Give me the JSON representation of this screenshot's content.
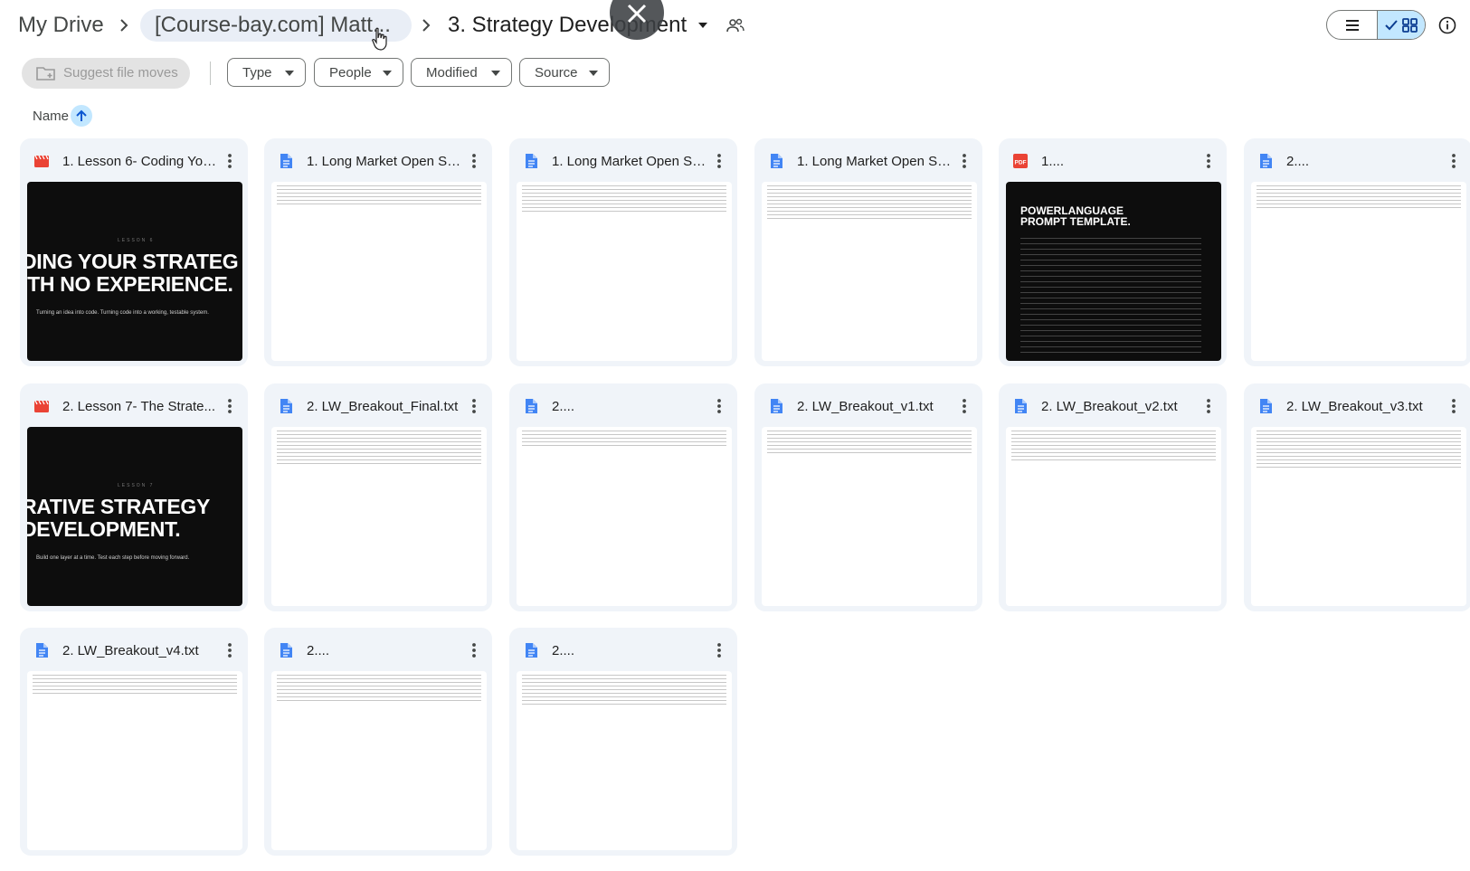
{
  "breadcrumb": {
    "root": "My Drive",
    "middle": "[Course-bay.com] Matt...",
    "current": "3. Strategy Development"
  },
  "toolbar": {
    "suggest_label": "Suggest file moves",
    "filters": [
      "Type",
      "People",
      "Modified",
      "Source"
    ]
  },
  "sort": {
    "label": "Name",
    "direction": "ascending"
  },
  "icons": {
    "video": "video-file-icon",
    "doc": "text-document-icon",
    "pdf": "pdf-file-icon",
    "colors": {
      "video": "#ea4335",
      "doc": "#4285f4",
      "pdf": "#ea4335",
      "accent": "#c2e7ff"
    }
  },
  "files": [
    {
      "name": "1. Lesson 6- Coding You...",
      "type": "video",
      "thumb": {
        "headline": "DING YOUR STRATEG\nITH NO EXPERIENCE.",
        "caption": "Turning an idea into code. Turning code into a working, testable system.",
        "kicker": "LESSON 6"
      }
    },
    {
      "name": "1. Long Market Open S&...",
      "type": "doc"
    },
    {
      "name": "1. Long Market Open S&...",
      "type": "doc"
    },
    {
      "name": "1. Long Market Open S&...",
      "type": "doc"
    },
    {
      "name": "1....",
      "type": "pdf",
      "thumb": {
        "headline": "POWERLANGUAGE\nPROMPT TEMPLATE."
      }
    },
    {
      "name": "2....",
      "type": "doc"
    },
    {
      "name": "2. Lesson 7- The Strate...",
      "type": "video",
      "thumb": {
        "headline": "RATIVE STRATEGY\nDEVELOPMENT.",
        "caption": "Build one layer at a time. Test each step before moving forward.",
        "kicker": "LESSON 7"
      }
    },
    {
      "name": "2. LW_Breakout_Final.txt",
      "type": "doc"
    },
    {
      "name": "2....",
      "type": "doc"
    },
    {
      "name": "2. LW_Breakout_v1.txt",
      "type": "doc"
    },
    {
      "name": "2. LW_Breakout_v2.txt",
      "type": "doc"
    },
    {
      "name": "2. LW_Breakout_v3.txt",
      "type": "doc"
    },
    {
      "name": "2. LW_Breakout_v4.txt",
      "type": "doc"
    },
    {
      "name": "2....",
      "type": "doc"
    },
    {
      "name": "2....",
      "type": "doc"
    }
  ]
}
